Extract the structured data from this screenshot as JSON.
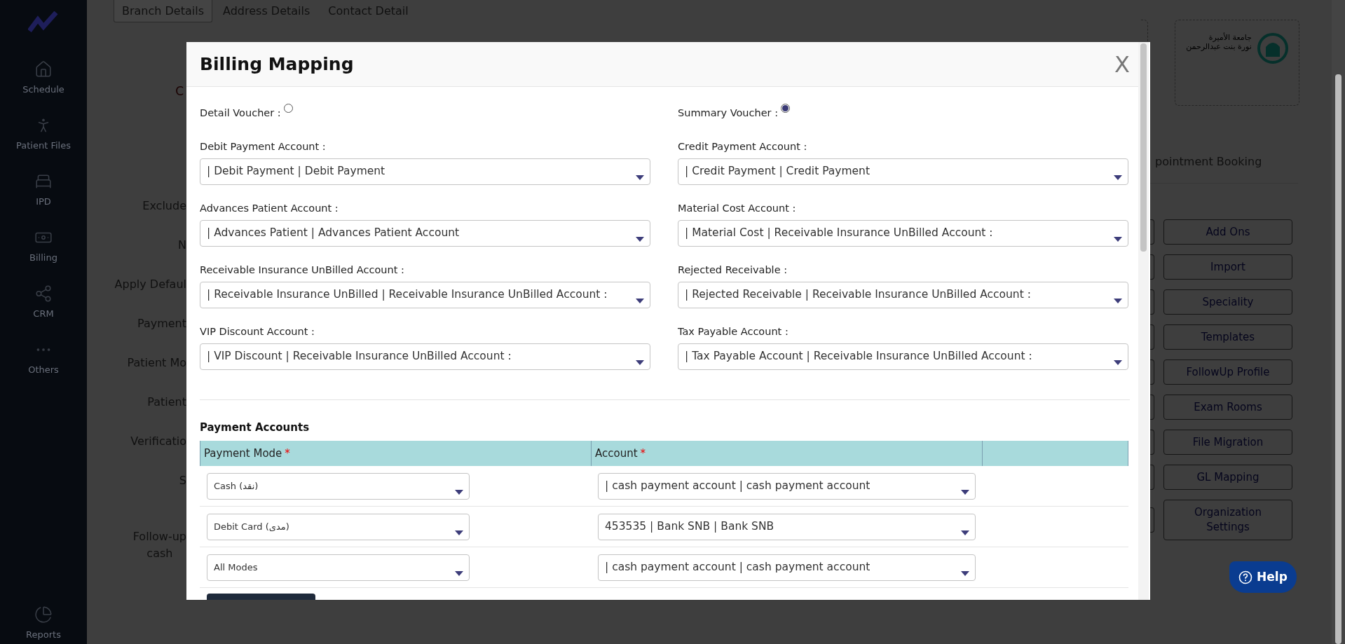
{
  "sidebar": {
    "items": [
      {
        "label": "Schedule"
      },
      {
        "label": "Patient Files"
      },
      {
        "label": "IPD"
      },
      {
        "label": "Billing"
      },
      {
        "label": "CRM"
      },
      {
        "label": "Others"
      }
    ],
    "footer": {
      "label": "Reports"
    }
  },
  "background": {
    "tabs": [
      {
        "label": "Branch Details",
        "selected": true
      },
      {
        "label": "Address Details",
        "selected": false
      },
      {
        "label": "Contact Detail",
        "selected": false
      }
    ],
    "error_mark": "C",
    "form_labels": [
      {
        "lines": [
          "Exclude"
        ]
      },
      {
        "lines": [
          "N"
        ]
      },
      {
        "lines": [
          "Apply Defaul"
        ]
      },
      {
        "lines": [
          "Payment"
        ]
      },
      {
        "lines": [
          "Patient Mo"
        ]
      },
      {
        "lines": [
          "Patient"
        ]
      },
      {
        "lines": [
          "Verificatio"
        ]
      },
      {
        "lines": [
          "S"
        ]
      },
      {
        "lines": [
          "Follow-up",
          "cash"
        ]
      }
    ],
    "logo": {
      "lines": [
        "جامعة الأميرة",
        "نورة بنت عبدالرحمن"
      ]
    },
    "partial_tab": "pointment Booking",
    "buttons": [
      "Add Ons",
      "Import",
      "Speciality",
      "Templates",
      "FollowUp Profile",
      "Exam Rooms",
      "File Migration",
      "GL Mapping",
      "Organization Settings"
    ]
  },
  "modal": {
    "title": "Billing Mapping",
    "close": "X",
    "vouchers": [
      {
        "label": "Detail Voucher :",
        "selected": false
      },
      {
        "label": "Summary Voucher :",
        "selected": true
      }
    ],
    "fields": [
      {
        "label": "Debit Payment Account :",
        "value": "| Debit Payment | Debit Payment"
      },
      {
        "label": "Credit Payment Account :",
        "value": "| Credit Payment | Credit Payment"
      },
      {
        "label": "Advances Patient Account :",
        "value": "| Advances Patient | Advances Patient Account"
      },
      {
        "label": "Material Cost Account :",
        "value": "| Material Cost | Receivable Insurance UnBilled Account :"
      },
      {
        "label": "Receivable Insurance UnBilled Account :",
        "value": "| Receivable Insurance UnBilled | Receivable Insurance UnBilled Account :"
      },
      {
        "label": "Rejected Receivable :",
        "value": "| Rejected Receivable | Receivable Insurance UnBilled Account :"
      },
      {
        "label": "VIP Discount Account :",
        "value": "| VIP Discount | Receivable Insurance UnBilled Account :"
      },
      {
        "label": "Tax Payable Account :",
        "value": "| Tax Payable Account | Receivable Insurance UnBilled Account :"
      }
    ],
    "section_title": "Payment Accounts",
    "table": {
      "required_mark": "*",
      "columns": [
        {
          "label": "Payment Mode",
          "required": true
        },
        {
          "label": "Account",
          "required": true
        }
      ],
      "rows": [
        {
          "mode": "Cash (نقد)",
          "account": "| cash payment account | cash payment account"
        },
        {
          "mode": "Debit Card (مدى)",
          "account": "453535 | Bank SNB | Bank SNB"
        },
        {
          "mode": "All Modes",
          "account": "| cash payment account | cash payment account"
        }
      ]
    }
  },
  "help": {
    "label": "Help"
  }
}
